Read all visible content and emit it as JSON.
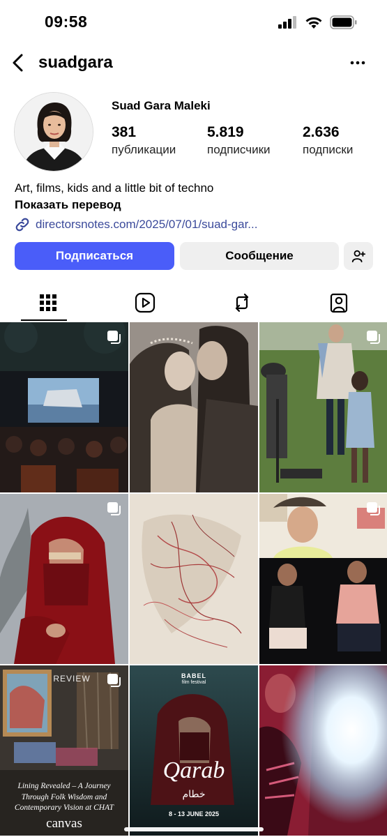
{
  "status": {
    "time": "09:58"
  },
  "nav": {
    "username": "suadgara"
  },
  "profile": {
    "full_name": "Suad Gara Maleki",
    "stats": [
      {
        "value": "381",
        "label": "публикации"
      },
      {
        "value": "5.819",
        "label": "подписчики"
      },
      {
        "value": "2.636",
        "label": "подписки"
      }
    ]
  },
  "bio": {
    "text": "Art, films, kids and a little bit of techno",
    "translate": "Показать перевод",
    "link": "directorsnotes.com/2025/07/01/suad-gar..."
  },
  "actions": {
    "follow": "Подписаться",
    "message": "Сообщение"
  },
  "tabs": [
    {
      "icon": "grid-icon",
      "active": true
    },
    {
      "icon": "reels-icon",
      "active": false
    },
    {
      "icon": "reposts-icon",
      "active": false
    },
    {
      "icon": "tagged-icon",
      "active": false
    }
  ],
  "posts": {
    "p7_badge": "REVIEW",
    "p7_caption": "Lining Revealed – A Journey Through Folk Wisdom and Contemporary Vision at CHAT",
    "p7_brand": "canvas",
    "p8_festival": "BABEL",
    "p8_festival_sub": "film festival",
    "p8_title": "Qarab",
    "p8_title_ar": "خطام",
    "p8_dates": "8 - 13 JUNE 2025"
  },
  "colors": {
    "accent": "#4a5df9",
    "link": "#3b4a9b"
  }
}
